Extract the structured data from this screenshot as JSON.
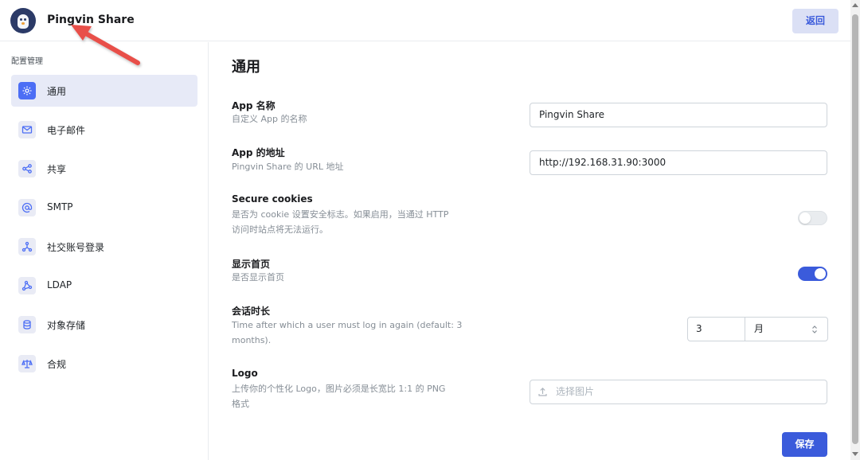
{
  "header": {
    "app_name": "Pingvin Share",
    "back_label": "返回"
  },
  "sidebar": {
    "title": "配置管理",
    "items": [
      {
        "label": "通用",
        "icon": "gear-icon",
        "active": true
      },
      {
        "label": "电子邮件",
        "icon": "mail-icon",
        "active": false
      },
      {
        "label": "共享",
        "icon": "share-icon",
        "active": false
      },
      {
        "label": "SMTP",
        "icon": "at-icon",
        "active": false
      },
      {
        "label": "社交账号登录",
        "icon": "social-login-icon",
        "active": false
      },
      {
        "label": "LDAP",
        "icon": "network-icon",
        "active": false
      },
      {
        "label": "对象存储",
        "icon": "database-icon",
        "active": false
      },
      {
        "label": "合规",
        "icon": "scale-icon",
        "active": false
      }
    ]
  },
  "main": {
    "title": "通用",
    "app_name": {
      "title": "App 名称",
      "desc": "自定义 App 的名称",
      "value": "Pingvin Share"
    },
    "app_url": {
      "title": "App 的地址",
      "desc": "Pingvin Share 的 URL 地址",
      "value": "http://192.168.31.90:3000"
    },
    "secure_cookies": {
      "title": "Secure cookies",
      "desc_line1": "是否为 cookie 设置安全标志。如果启用，当通过 HTTP",
      "desc_line2": "访问时站点将无法运行。",
      "enabled": false
    },
    "show_home": {
      "title": "显示首页",
      "desc": "是否显示首页",
      "enabled": true
    },
    "session": {
      "title": "会话时长",
      "desc_line1": "Time after which a user must log in again (default: 3",
      "desc_line2": "months).",
      "value": "3",
      "unit": "月"
    },
    "logo": {
      "title": "Logo",
      "desc_line1": "上传你的个性化 Logo，图片必须是长宽比 1:1 的 PNG",
      "desc_line2": "格式",
      "placeholder": "选择图片"
    },
    "save_label": "保存"
  },
  "colors": {
    "accent": "#3b5bdb",
    "accent_light": "#dbe0f5",
    "active_nav_bg": "#e7eaf7",
    "annotation_arrow": "#e8504a"
  }
}
